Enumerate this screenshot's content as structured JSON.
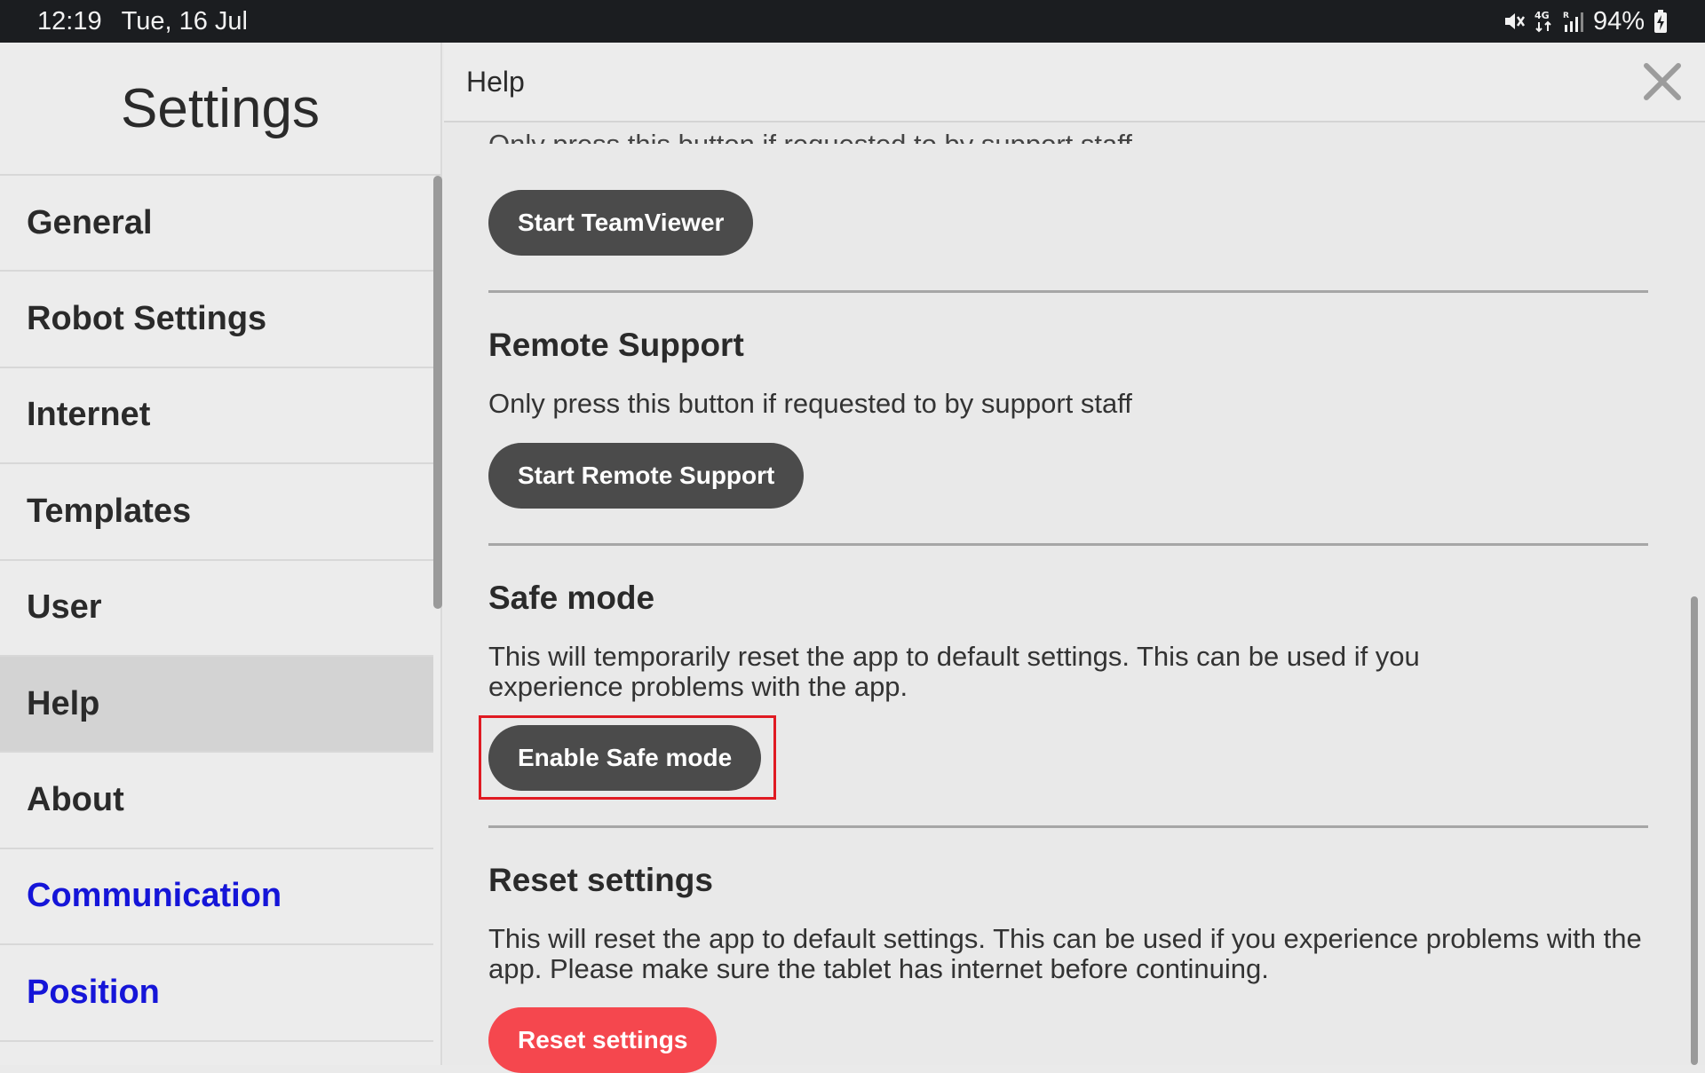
{
  "status_bar": {
    "time": "12:19",
    "date": "Tue, 16 Jul",
    "battery": "94%",
    "icons": [
      "mute-icon",
      "network-4g-icon",
      "signal-icon",
      "battery-charging-icon"
    ]
  },
  "sidebar": {
    "title": "Settings",
    "items": [
      {
        "label": "General"
      },
      {
        "label": "Robot Settings"
      },
      {
        "label": "Internet"
      },
      {
        "label": "Templates"
      },
      {
        "label": "User"
      },
      {
        "label": "Help"
      },
      {
        "label": "About"
      },
      {
        "label": "Communication"
      },
      {
        "label": "Position"
      }
    ],
    "active": "Help"
  },
  "panel": {
    "title": "Help",
    "close_icon": "close-icon",
    "sections": {
      "teamviewer": {
        "cut_text": "Only press this button if requested to by support staff",
        "button": "Start TeamViewer"
      },
      "remote_support": {
        "title": "Remote Support",
        "description": "Only press this button if requested to by support staff",
        "button": "Start Remote Support"
      },
      "safe_mode": {
        "title": "Safe mode",
        "description": "This will temporarily reset the app to default settings. This can be used if you experience problems with the app.",
        "button": "Enable Safe mode"
      },
      "reset_settings": {
        "title": "Reset settings",
        "description": "This will reset the app to default settings. This can be used if you experience problems with the app. Please make sure the tablet has internet before continuing.",
        "button": "Reset settings"
      }
    }
  },
  "colors": {
    "status_bar": "#1b1d20",
    "button_dark": "#4b4b4b",
    "button_danger": "#f5474e",
    "link_blue": "#1515d8",
    "highlight_red": "#e01a22"
  }
}
